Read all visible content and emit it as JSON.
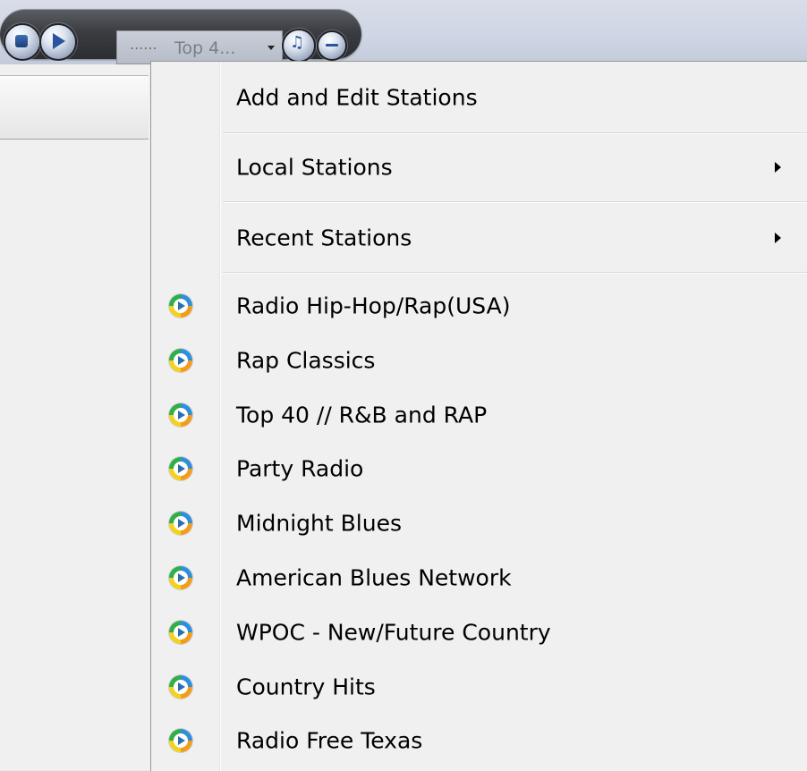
{
  "toolbar": {
    "now_playing_dots": "......",
    "now_playing_station": "Top 4..."
  },
  "menu": {
    "actions": [
      {
        "label": "Add and Edit Stations",
        "has_submenu": false
      },
      {
        "label": "Local Stations",
        "has_submenu": true
      },
      {
        "label": "Recent Stations",
        "has_submenu": true
      }
    ],
    "stations": [
      "Radio Hip-Hop/Rap(USA)",
      "Rap Classics",
      "Top 40 // R&B and RAP",
      "Party Radio",
      "Midnight Blues",
      "American Blues Network",
      "WPOC - New/Future Country",
      "Country Hits",
      "Radio Free Texas"
    ]
  },
  "icons": {
    "stop": "stop-icon",
    "play": "play-icon",
    "dropdown": "chevron-down-icon",
    "volume": "volume-icon",
    "minimize": "minimize-icon",
    "submenu_arrow": "chevron-right-icon",
    "station": "windows-media-station-icon"
  }
}
